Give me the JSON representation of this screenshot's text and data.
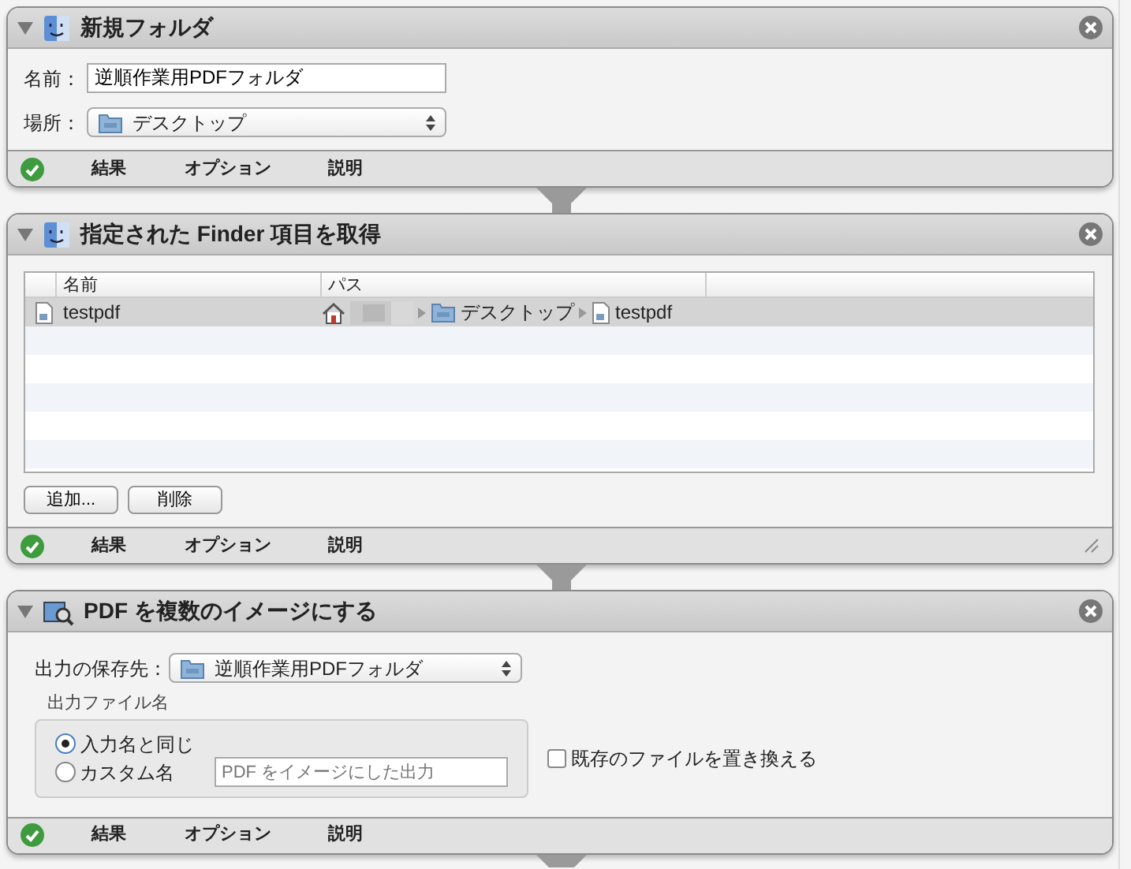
{
  "actions": [
    {
      "kind": "new_folder",
      "title": "新規フォルダ",
      "fields": [
        {
          "kind": "text",
          "label": "名前：",
          "value": "逆順作業用PDFフォルダ"
        },
        {
          "kind": "popup",
          "label": "場所：",
          "value": "デスクトップ"
        }
      ],
      "footer": {
        "succeeded": true,
        "tabs": [
          "結果",
          "オプション",
          "説明"
        ]
      }
    },
    {
      "kind": "finder_items",
      "title": "指定された Finder 項目を取得",
      "columns": [
        "名前",
        "パス"
      ],
      "rows": [
        {
          "name": "testpdf",
          "selected": true,
          "path": [
            {
              "kind": "home"
            },
            {
              "kind": "redacted"
            },
            {
              "kind": "folder",
              "label": "デスクトップ"
            },
            {
              "kind": "file",
              "label": "testpdf"
            }
          ]
        }
      ],
      "buttons": [
        "追加...",
        "削除"
      ],
      "footer": {
        "succeeded": true,
        "tabs": [
          "結果",
          "オプション",
          "説明"
        ]
      },
      "resizable": true
    },
    {
      "kind": "pdf_images",
      "title": "PDF を複数のイメージにする",
      "dest_label": "出力の保存先：",
      "dest_value": "逆順作業用PDFフォルダ",
      "group_label": "出力ファイル名",
      "radios": [
        {
          "label": "入力名と同じ",
          "selected": true
        },
        {
          "label": "カスタム名",
          "selected": false,
          "placeholder": "PDF をイメージにした出力"
        }
      ],
      "checkbox": {
        "label": "既存のファイルを置き換える",
        "checked": false
      },
      "footer": {
        "succeeded": true,
        "tabs": [
          "結果",
          "オプション",
          "説明"
        ]
      }
    }
  ]
}
